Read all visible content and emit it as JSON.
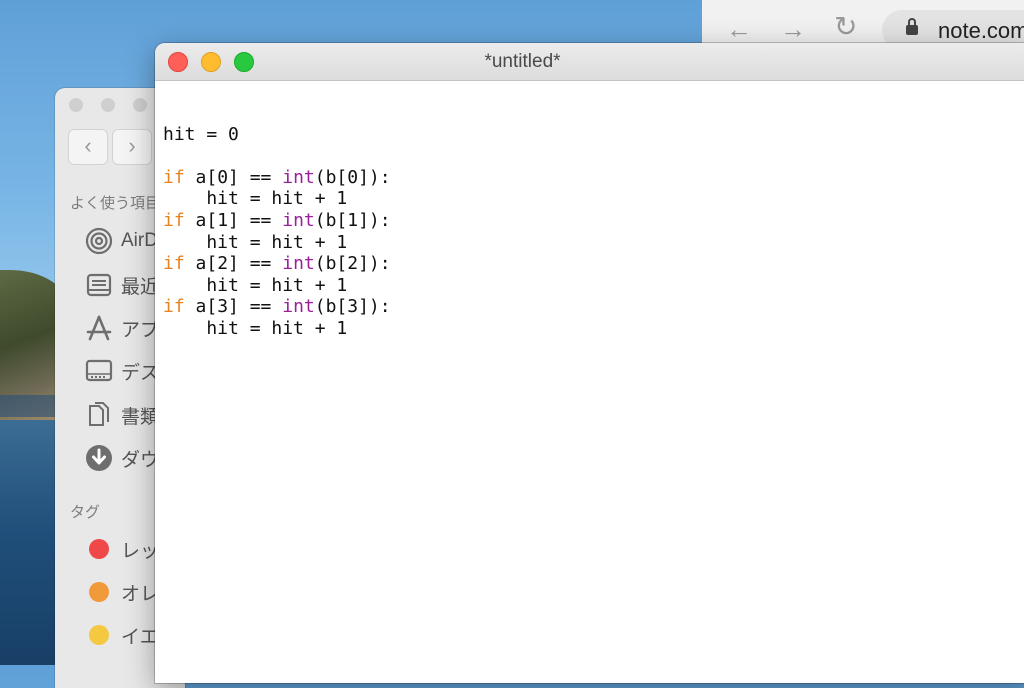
{
  "browser": {
    "url": "note.com",
    "colors": {
      "bar": "#f1f1f1",
      "field": "#e3e3e3"
    }
  },
  "finder": {
    "favorites_label": "よく使う項目",
    "items": [
      {
        "label": "AirDrop",
        "icon": "airdrop-icon"
      },
      {
        "label": "最近の項目",
        "icon": "recents-icon"
      },
      {
        "label": "アプリケーション",
        "icon": "applications-icon"
      },
      {
        "label": "デスクトップ",
        "icon": "desktop-icon"
      },
      {
        "label": "書類",
        "icon": "documents-icon"
      },
      {
        "label": "ダウンロード",
        "icon": "downloads-icon"
      }
    ],
    "tags_label": "タグ",
    "tags": [
      {
        "label": "レッド",
        "color": "#f04848"
      },
      {
        "label": "オレンジ",
        "color": "#f09a3c"
      },
      {
        "label": "イエロー",
        "color": "#f5c842"
      }
    ]
  },
  "editor": {
    "title": "*untitled*",
    "code_lines": [
      [],
      [
        {
          "t": "hit = 0"
        }
      ],
      [],
      [
        {
          "t": "if",
          "c": "kw"
        },
        {
          "t": " a[0] == "
        },
        {
          "t": "int",
          "c": "bi"
        },
        {
          "t": "(b[0]):"
        }
      ],
      [
        {
          "t": "    hit = hit + 1"
        }
      ],
      [
        {
          "t": "if",
          "c": "kw"
        },
        {
          "t": " a[1] == "
        },
        {
          "t": "int",
          "c": "bi"
        },
        {
          "t": "(b[1]):"
        }
      ],
      [
        {
          "t": "    hit = hit + 1"
        }
      ],
      [
        {
          "t": "if",
          "c": "kw"
        },
        {
          "t": " a[2] == "
        },
        {
          "t": "int",
          "c": "bi"
        },
        {
          "t": "(b[2]):"
        }
      ],
      [
        {
          "t": "    hit = hit + 1"
        }
      ],
      [
        {
          "t": "if",
          "c": "kw"
        },
        {
          "t": " a[3] == "
        },
        {
          "t": "int",
          "c": "bi"
        },
        {
          "t": "(b[3]):"
        }
      ],
      [
        {
          "t": "    hit = hit + 1"
        }
      ]
    ],
    "colors": {
      "keyword": "#e8821e",
      "builtin": "#9b1f9b",
      "text": "#111111"
    }
  }
}
